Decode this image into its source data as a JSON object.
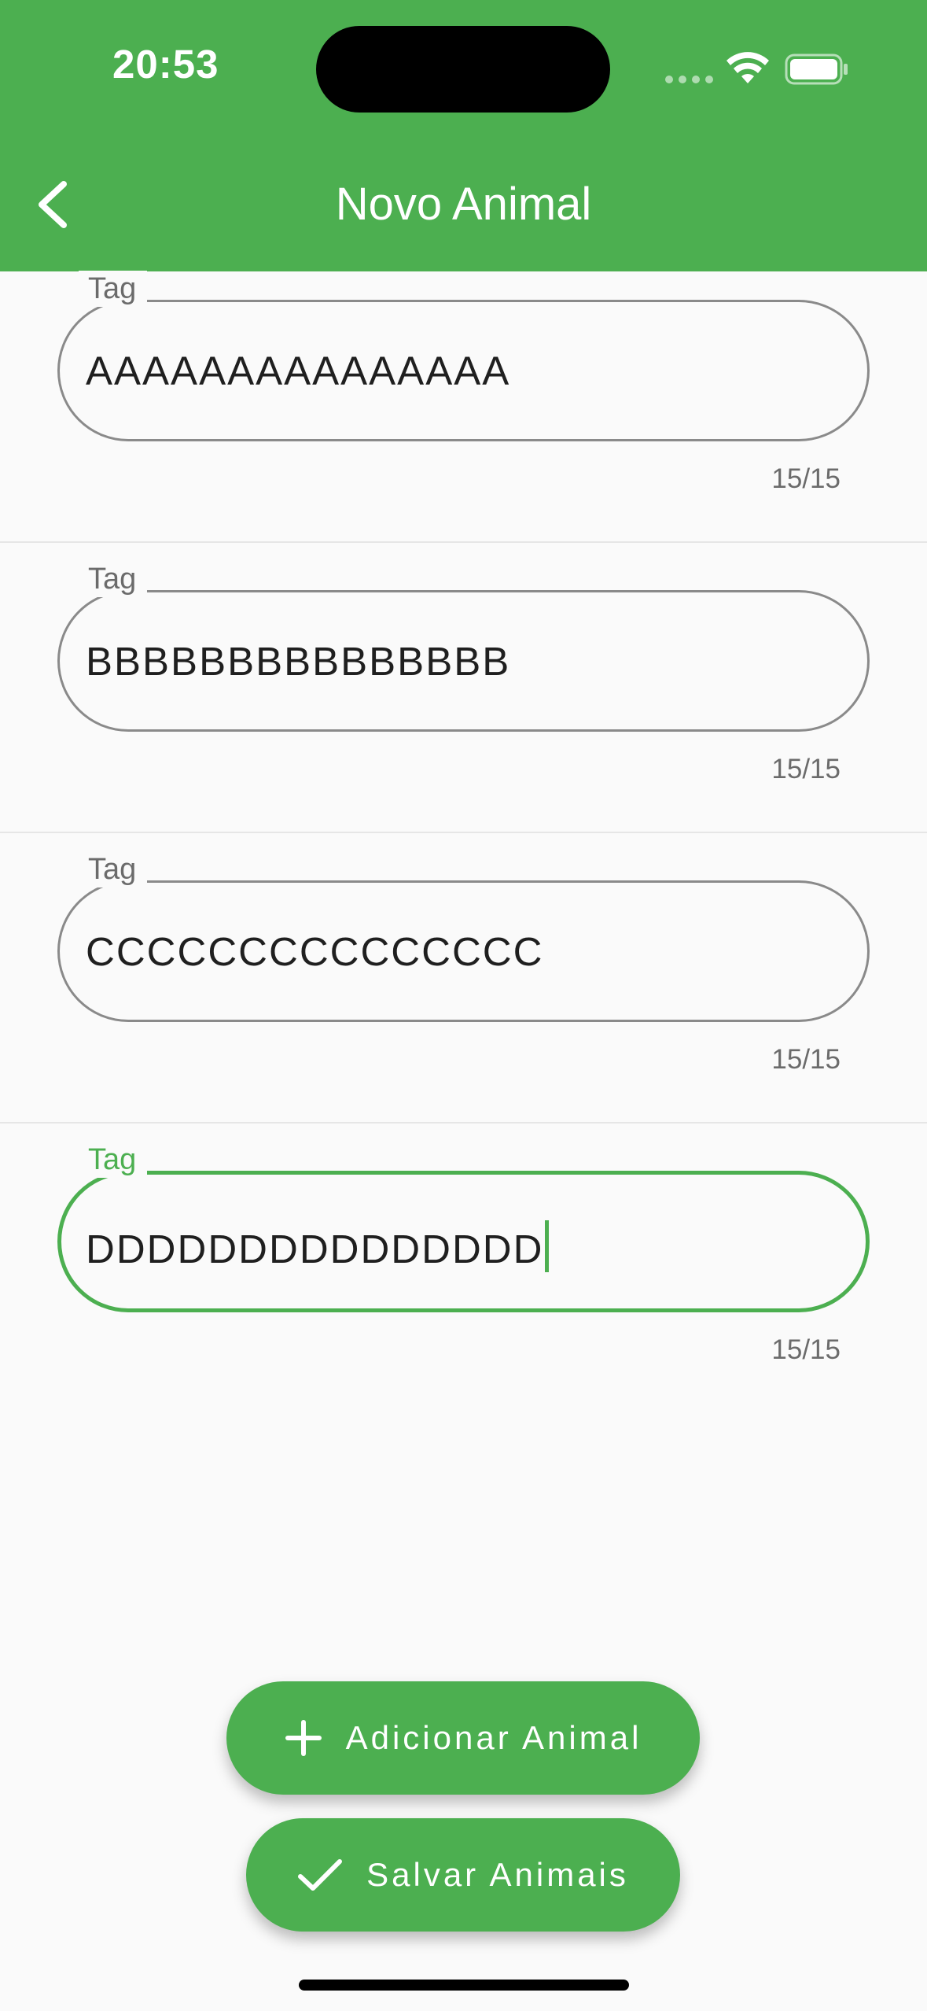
{
  "status_bar": {
    "time": "20:53"
  },
  "appbar": {
    "title": "Novo Animal",
    "back_icon": "chevron-left-icon",
    "color": "#4caf50"
  },
  "fields": [
    {
      "label": "Tag",
      "value": "AAAAAAAAAAAAAAA",
      "counter": "15/15",
      "focused": false
    },
    {
      "label": "Tag",
      "value": "BBBBBBBBBBBBBBB",
      "counter": "15/15",
      "focused": false
    },
    {
      "label": "Tag",
      "value": "CCCCCCCCCCCCCCC",
      "counter": "15/15",
      "focused": false
    },
    {
      "label": "Tag",
      "value": "DDDDDDDDDDDDDDD",
      "counter": "15/15",
      "focused": true
    }
  ],
  "actions": {
    "add_label": "Adicionar Animal",
    "add_icon": "plus-icon",
    "save_label": "Salvar Animais",
    "save_icon": "check-icon"
  }
}
